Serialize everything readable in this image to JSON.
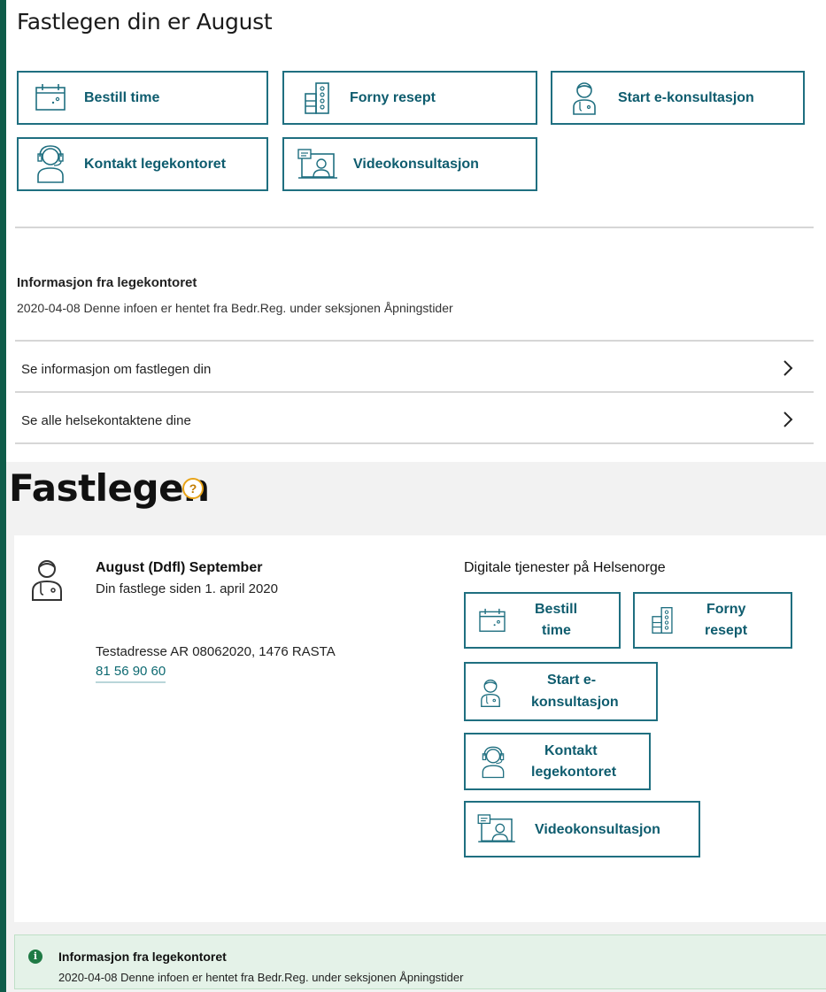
{
  "top": {
    "title": "Fastlegen din er August",
    "buttons": {
      "bestill": "Bestill time",
      "forny": "Forny resept",
      "ekons": "Start e-konsultasjon",
      "kontakt": "Kontakt legekontoret",
      "video": "Videokonsultasjon"
    },
    "info_heading": "Informasjon fra legekontoret",
    "info_text": "2020-04-08 Denne infoen er hentet fra Bedr.Reg. under seksjonen Åpningstider",
    "links": [
      "Se informasjon om fastlegen din",
      "Se alle helsekontaktene dine"
    ]
  },
  "bottom": {
    "title": "Fastlegen",
    "help_symbol": "?",
    "doctor": {
      "name": "August (Ddfl) September",
      "since": "Din fastlege siden 1. april 2020",
      "address": "Testadresse AR 08062020, 1476 RASTA",
      "phone": "81 56 90 60"
    },
    "digital_title": "Digitale tjenester på Helsenorge",
    "buttons": {
      "bestill_1": "Bestill",
      "bestill_2": "time",
      "forny_1": "Forny",
      "forny_2": "resept",
      "ekons_1": "Start e-",
      "ekons_2": "konsultasjon",
      "kontakt_1": "Kontakt",
      "kontakt_2": "legekontoret",
      "video": "Videokonsultasjon"
    },
    "notice": {
      "icon": "i",
      "heading": "Informasjon fra legekontoret",
      "text": "2020-04-08 Denne infoen er hentet fra Bedr.Reg. under seksjonen Åpningstider"
    }
  },
  "colors": {
    "accent": "#1f6f80",
    "button_text": "#0e5c6e",
    "left_bar": "#0f5c4a",
    "notice_bg": "#e4f2e8",
    "help": "#e8a317"
  },
  "icons": [
    "calendar-icon",
    "pill-box-icon",
    "doctor-icon",
    "headset-icon",
    "video-chat-icon",
    "chevron-right-icon",
    "help-icon",
    "info-icon"
  ]
}
